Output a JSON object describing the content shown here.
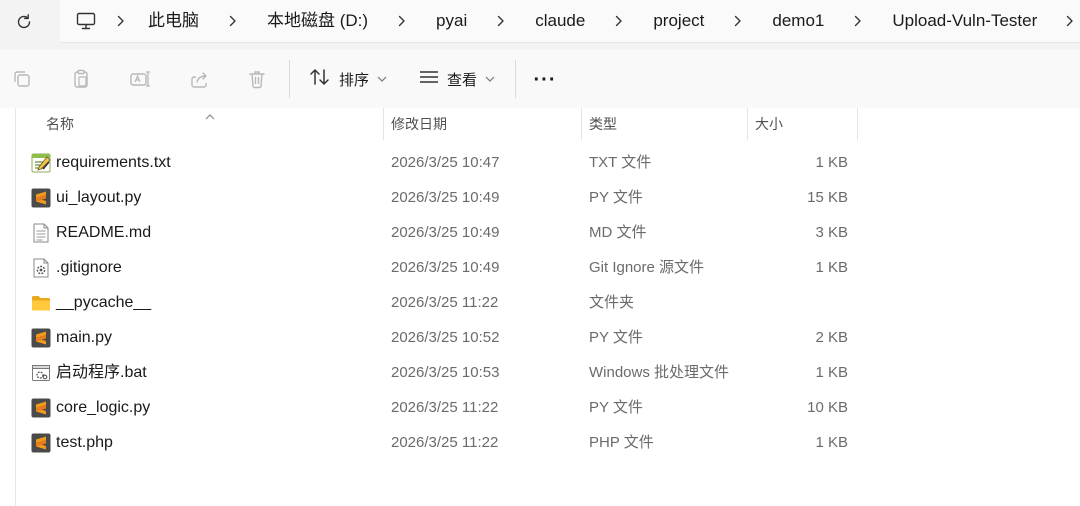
{
  "address_bar": {
    "breadcrumbs": [
      {
        "label": "此电脑"
      },
      {
        "label": "本地磁盘 (D:)"
      },
      {
        "label": "pyai"
      },
      {
        "label": "claude"
      },
      {
        "label": "project"
      },
      {
        "label": "demo1"
      },
      {
        "label": "Upload-Vuln-Tester"
      }
    ]
  },
  "toolbar": {
    "sort_label": "排序",
    "view_label": "查看",
    "more_label": "···"
  },
  "columns": {
    "name": "名称",
    "modified": "修改日期",
    "type": "类型",
    "size": "大小"
  },
  "files": [
    {
      "name": "requirements.txt",
      "modified": "2026/3/25 10:47",
      "type": "TXT 文件",
      "size": "1 KB",
      "icon": "text-file-icon"
    },
    {
      "name": "ui_layout.py",
      "modified": "2026/3/25 10:49",
      "type": "PY 文件",
      "size": "15 KB",
      "icon": "sublime-file-icon"
    },
    {
      "name": "README.md",
      "modified": "2026/3/25 10:49",
      "type": "MD 文件",
      "size": "3 KB",
      "icon": "document-file-icon"
    },
    {
      "name": ".gitignore",
      "modified": "2026/3/25 10:49",
      "type": "Git Ignore 源文件",
      "size": "1 KB",
      "icon": "settings-file-icon"
    },
    {
      "name": "__pycache__",
      "modified": "2026/3/25 11:22",
      "type": "文件夹",
      "size": "",
      "icon": "folder-icon"
    },
    {
      "name": "main.py",
      "modified": "2026/3/25 10:52",
      "type": "PY 文件",
      "size": "2 KB",
      "icon": "sublime-file-icon"
    },
    {
      "name": "启动程序.bat",
      "modified": "2026/3/25 10:53",
      "type": "Windows 批处理文件",
      "size": "1 KB",
      "icon": "batch-file-icon"
    },
    {
      "name": "core_logic.py",
      "modified": "2026/3/25 11:22",
      "type": "PY 文件",
      "size": "10 KB",
      "icon": "sublime-file-icon"
    },
    {
      "name": "test.php",
      "modified": "2026/3/25 11:22",
      "type": "PHP 文件",
      "size": "1 KB",
      "icon": "sublime-file-icon"
    }
  ],
  "colors": {
    "accent": "#ffc83d",
    "sublime": "#e87b1c"
  }
}
